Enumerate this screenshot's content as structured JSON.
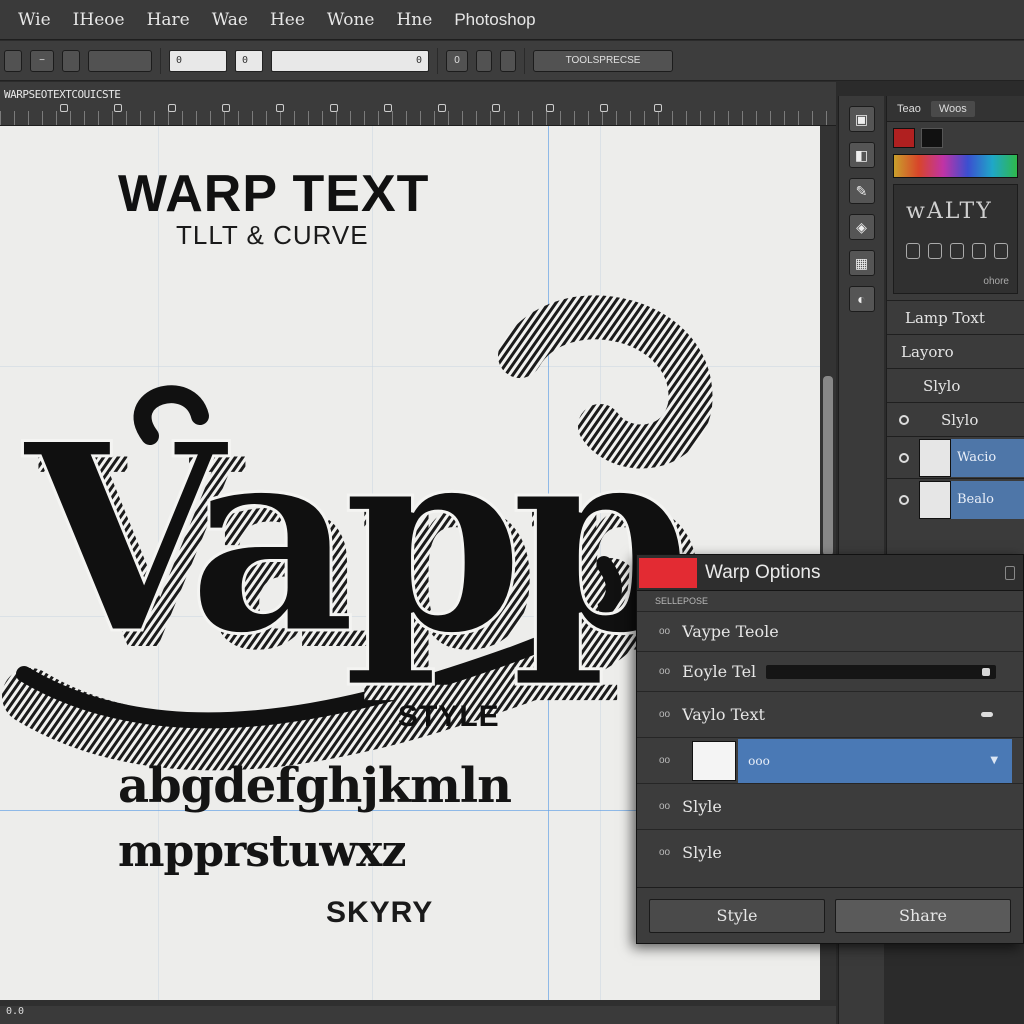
{
  "menu": {
    "items": [
      "Wie",
      "IHeoe",
      "Hare",
      "Wae",
      "Hee",
      "Wone",
      "Hne"
    ],
    "app_label": "Photoshop"
  },
  "options_bar": {
    "button_a": "−",
    "button_b": "0",
    "field_a": "0",
    "field_b": "0",
    "field_c": "0",
    "wide_button": "TOOLSPRECSE"
  },
  "ruler": {
    "label": "WARPSEOTEXTCOUICSTE"
  },
  "canvas": {
    "heading": "WARP TEXT",
    "subheading": "TLLT & CURVE",
    "art_word": "Vapp",
    "style_label": "STYLE",
    "alphabet_line1": "abgdefghjkmln",
    "alphabet_line2": "mpprstuwxz",
    "footer_word": "SKYRY"
  },
  "status_bar": {
    "text": "0.0"
  },
  "right_panel": {
    "tabs": [
      "Teao",
      "Woos"
    ],
    "glyph_preview": "wALTY",
    "glyph_footer": "ohore",
    "rows": [
      "Lamp Toxt",
      "Layoro",
      "Slylo",
      "Slylo"
    ],
    "layers": [
      {
        "name": "Wacio"
      },
      {
        "name": "Bealo"
      }
    ]
  },
  "dialog": {
    "title": "Warp Options",
    "caption": "SELLEPOSE",
    "rows": [
      {
        "tick": "oo",
        "label": "Vaype Teole"
      },
      {
        "tick": "oo",
        "label": "Eoyle Tel"
      },
      {
        "tick": "oo",
        "label": "Vaylo Text"
      },
      {
        "tick": "oo",
        "label": "ooo"
      },
      {
        "tick": "oo",
        "label": "Slyle"
      },
      {
        "tick": "oo",
        "label": "Slyle"
      }
    ],
    "buttons": {
      "left": "Style",
      "right": "Share"
    }
  },
  "colors": {
    "accent_red": "#e32b33",
    "selection_blue": "#4a79b5",
    "guide_blue": "#66a3e6"
  }
}
